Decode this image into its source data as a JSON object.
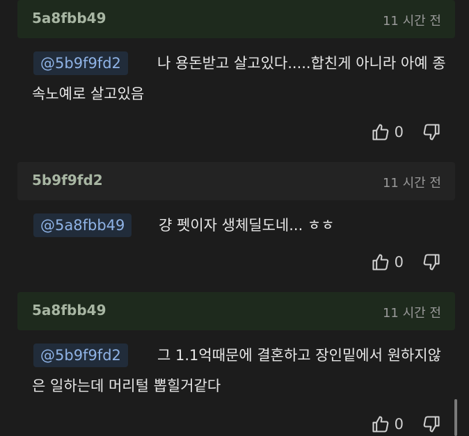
{
  "comments": [
    {
      "author": "5a8fbb49",
      "time": "11 시간 전",
      "mention": "@5b9f9fd2",
      "text": "나 용돈받고 살고있다.....합친게 아니라 아예 종속노예로 살고있음",
      "likes": "0"
    },
    {
      "author": "5b9f9fd2",
      "time": "11 시간 전",
      "mention": "@5a8fbb49",
      "text": "걍 펫이자 생체딜도네... ㅎㅎ",
      "likes": "0"
    },
    {
      "author": "5a8fbb49",
      "time": "11 시간 전",
      "mention": "@5b9f9fd2",
      "text": "그 1.1억때문에 결혼하고 장인밑에서 원하지않은 일하는데 머리털 뽑힐거같다",
      "likes": "0"
    }
  ],
  "icons": {
    "like": "thumbs-up-icon",
    "dislike": "thumbs-down-icon"
  }
}
